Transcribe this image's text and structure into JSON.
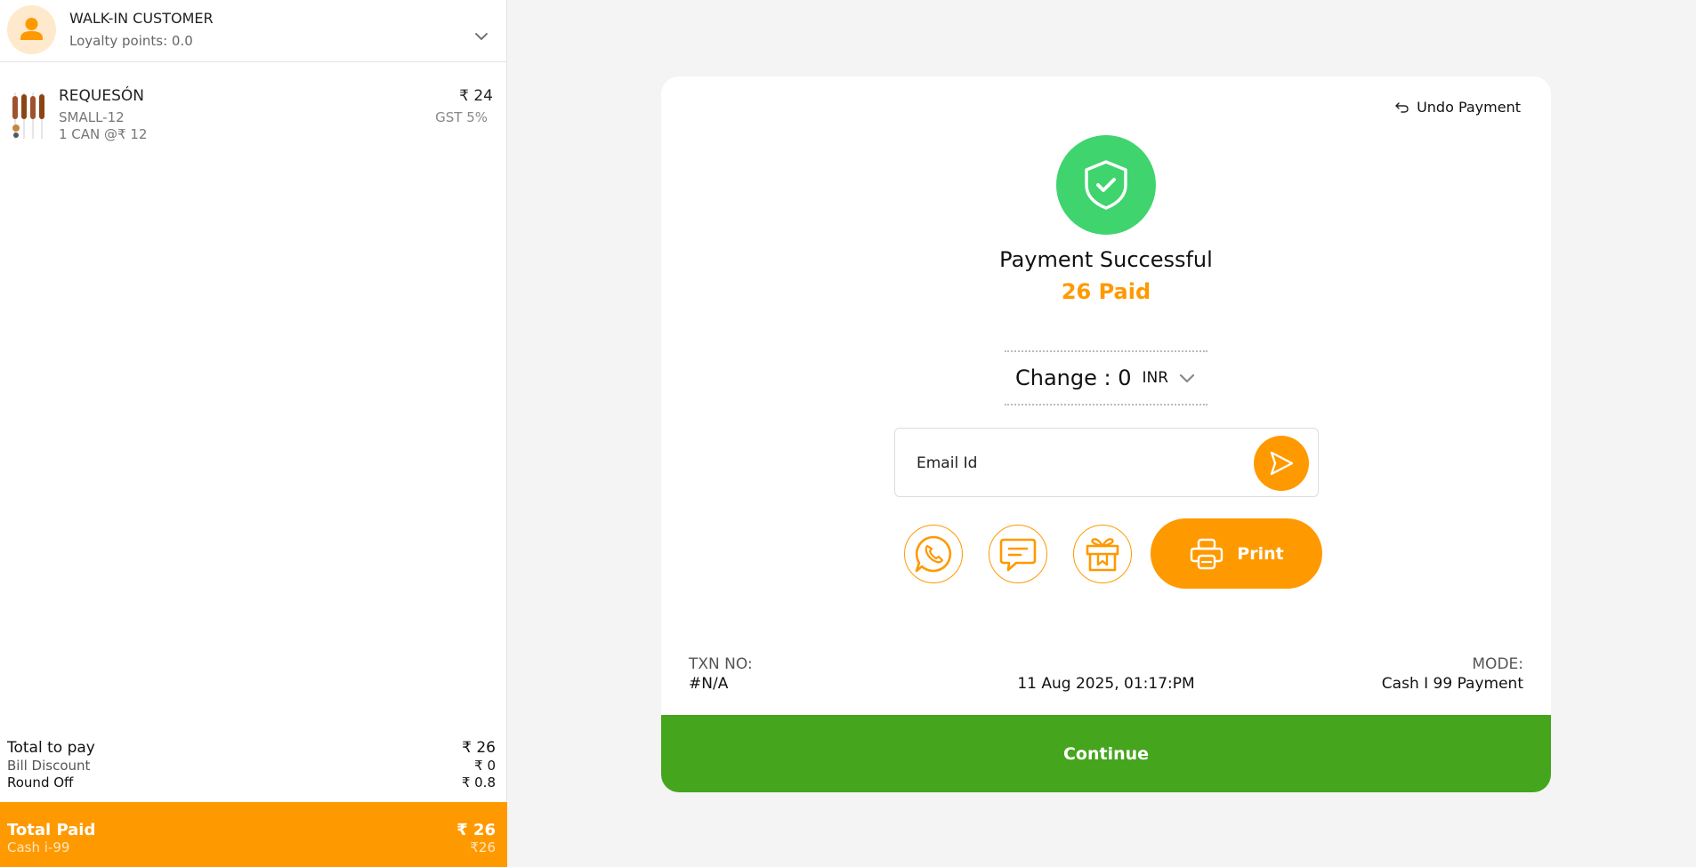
{
  "customer": {
    "name": "WALK-IN CUSTOMER",
    "loyalty": "Loyalty points: 0.0",
    "avatar_icon": "user-icon",
    "dropdown_icon": "chevron-down-icon"
  },
  "cart": {
    "items": [
      {
        "name": "REQUESÓN",
        "variant": "SMALL-12",
        "qty_line": "1 CAN @₹ 12",
        "price": "₹ 24",
        "gst": "GST 5%"
      }
    ]
  },
  "totals": {
    "total_label": "Total to pay",
    "total_value": "₹ 26",
    "discount_label": "Bill Discount",
    "discount_value": "₹ 0",
    "roundoff_label": "Round Off",
    "roundoff_value": "₹ 0.8"
  },
  "paid": {
    "label": "Total Paid",
    "value": "₹ 26",
    "method": "Cash i-99",
    "method_value": "₹26"
  },
  "payment": {
    "undo_label": "Undo Payment",
    "title": "Payment Successful",
    "amount": "26 Paid",
    "change_label": "Change : 0",
    "currency": "INR",
    "email_placeholder": "Email Id",
    "print_label": "Print",
    "txn_label": "TXN NO:",
    "txn_value": "#N/A",
    "datetime": "11 Aug 2025, 01:17:PM",
    "mode_label": "MODE:",
    "mode_value": "Cash I 99  Payment",
    "continue_label": "Continue"
  },
  "colors": {
    "accent": "#ff9900",
    "success": "#3fd46d",
    "continue": "#45a51d"
  }
}
